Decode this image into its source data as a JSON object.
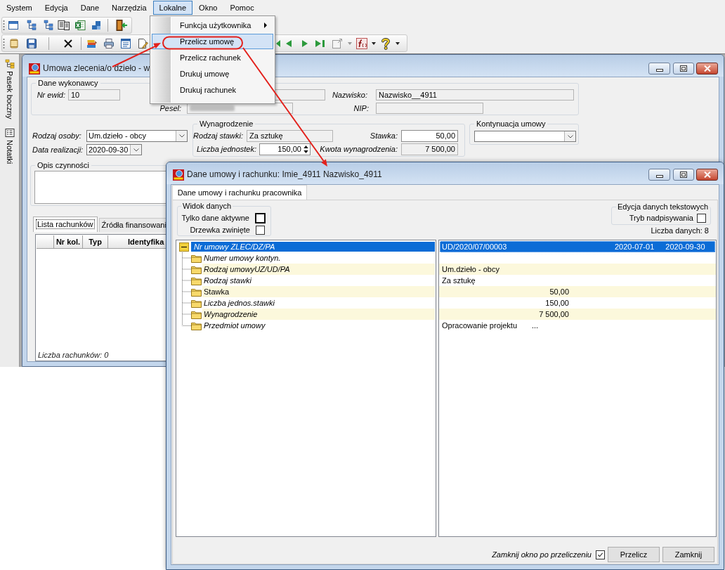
{
  "menu_bar": [
    {
      "label": "System",
      "selected": false
    },
    {
      "label": "Edycja",
      "selected": false
    },
    {
      "label": "Dane",
      "selected": false
    },
    {
      "label": "Narzędzia",
      "selected": false
    },
    {
      "label": "Lokalne",
      "selected": true
    },
    {
      "label": "Okno",
      "selected": false
    },
    {
      "label": "Pomoc",
      "selected": false
    }
  ],
  "menu_popup": [
    {
      "label": "Funkcja użytkownika",
      "submenu": true,
      "selected": false
    },
    {
      "label": "Przelicz umowę",
      "submenu": false,
      "selected": true
    },
    {
      "label": "Przelicz rachunek",
      "submenu": false,
      "selected": false
    },
    {
      "label": "Drukuj umowę",
      "submenu": false,
      "selected": false
    },
    {
      "label": "Drukuj rachunek",
      "submenu": false,
      "selected": false
    }
  ],
  "sidebar": {
    "items": [
      {
        "label": "Pasek boczny"
      },
      {
        "label": "Notatki"
      }
    ]
  },
  "contract_window": {
    "title": "Umowa zlecenia/o dzieło - w",
    "contractor": {
      "title": "Dane wykonawcy",
      "nr_ewid": {
        "label": "Nr ewid:",
        "value": "10",
        "readonly": true
      },
      "partly_hidden_field": {
        "readonly": true
      },
      "nazwisko": {
        "label": "Nazwisko:",
        "value": "Nazwisko__4911",
        "readonly": true
      },
      "pesel": {
        "label": "Pesel:",
        "readonly": true,
        "redacted": true
      },
      "nip": {
        "label": "NIP:",
        "readonly": true
      }
    },
    "rodzaj_osoby": {
      "label": "Rodzaj osoby:",
      "value": "Um.dzieło - obcy"
    },
    "data_realizacji": {
      "label": "Data realizacji:",
      "value": "2020-09-30"
    },
    "wynagrodzenie": {
      "title": "Wynagrodzenie",
      "rodzaj_stawki": {
        "label": "Rodzaj stawki:",
        "value": "Za sztukę",
        "readonly": true
      },
      "stawka": {
        "label": "Stawka:",
        "value": "50,00",
        "readonly": false
      },
      "liczba_jednostek": {
        "label": "Liczba jednostek:",
        "value": "150,00",
        "readonly": false
      },
      "kwota": {
        "label": "Kwota wynagrodzenia:",
        "value": "7 500,00",
        "readonly": true
      }
    },
    "kontynuacja": {
      "title": "Kontynuacja umowy"
    },
    "opis": {
      "title": "Opis czynności"
    },
    "tabs": [
      {
        "label": "Lista rachunków",
        "selected": true
      },
      {
        "label": "Źródła finansowani",
        "selected": false
      }
    ],
    "table": {
      "columns": [
        "Nr kol.",
        "Typ",
        "Identyfika"
      ],
      "footer": "Liczba rachunków: 0"
    }
  },
  "dialog": {
    "title": "Dane umowy i rachunku: Imie_4911 Nazwisko_4911",
    "tabs": [
      {
        "label": "Dane umowy i rachunku pracownika",
        "selected": true
      }
    ],
    "view_options": {
      "title": "Widok danych",
      "options": [
        {
          "label": "Tylko dane aktywne",
          "checked": false,
          "focused": true
        },
        {
          "label": "Drzewka zwinięte",
          "checked": false,
          "focused": false
        }
      ]
    },
    "text_editing": {
      "title": "Edycja danych tekstowych",
      "options": [
        {
          "label": "Tryb nadpisywania",
          "checked": false,
          "focused": false
        }
      ]
    },
    "data_count": "Liczba danych: 8",
    "tree": [
      {
        "label": "Nr umowy ZLEC/DZ/PA",
        "italic": true,
        "selected": true,
        "expanded": true,
        "kind": "text",
        "value": "UD/2020/07/00003",
        "date_from": "2020-07-01",
        "date_to": "2020-09-30",
        "children": [
          {
            "label": "Numer umowy kontyn.",
            "italic": true,
            "selected": false,
            "kind": "text"
          },
          {
            "label": "Rodzaj umowyUZ/UD/PA",
            "italic": true,
            "selected": false,
            "kind": "text",
            "value": "Um.dzieło - obcy"
          },
          {
            "label": "Rodzaj stawki",
            "italic": true,
            "selected": false,
            "kind": "text",
            "value": "Za sztukę"
          },
          {
            "label": "Stawka",
            "italic": false,
            "selected": false,
            "kind": "number",
            "value": "50,00"
          },
          {
            "label": "Liczba jednos.stawki",
            "italic": true,
            "selected": false,
            "kind": "number",
            "value": "150,00"
          },
          {
            "label": "Wynagrodzenie",
            "italic": true,
            "selected": false,
            "kind": "number",
            "value": "7 500,00"
          },
          {
            "label": "Przedmiot umowy",
            "italic": true,
            "selected": false,
            "kind": "text",
            "value": "Opracowanie projektu",
            "ellipsis": "..."
          }
        ]
      }
    ],
    "close_after": {
      "label": "Zamknij okno po przeliczeniu",
      "checked": true
    },
    "buttons": [
      "Przelicz",
      "Zamknij"
    ]
  }
}
